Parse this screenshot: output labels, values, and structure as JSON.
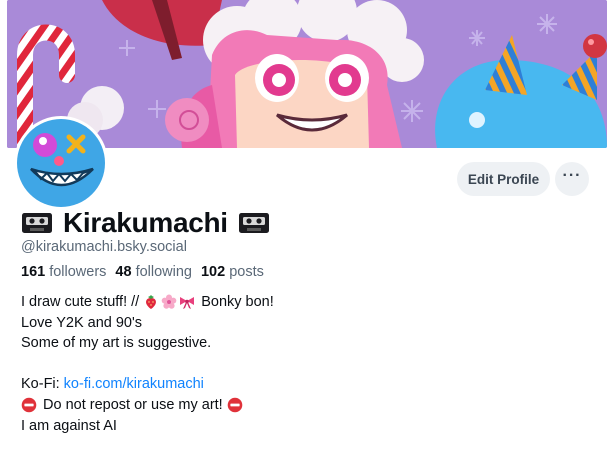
{
  "profile": {
    "display_name": "Kirakumachi",
    "name_prefix_icon": "videocassette-icon",
    "name_suffix_icon": "videocassette-icon",
    "handle": "@kirakumachi.bsky.social",
    "followers_count": "161",
    "followers_label": "followers",
    "following_count": "48",
    "following_label": "following",
    "posts_count": "102",
    "posts_label": "posts"
  },
  "actions": {
    "edit_label": "Edit Profile",
    "more_label": "···"
  },
  "bio": {
    "line1_text": "I draw cute stuff! //",
    "line1_emojis": [
      "strawberry-icon",
      "cherry-blossom-icon",
      "ribbon-icon"
    ],
    "line1_suffix": "Bonky bon!",
    "line2": "Love Y2K and 90's",
    "line3": "Some of my art is suggestive.",
    "line5_label": "Ko-Fi:",
    "line5_link": "ko-fi.com/kirakumachi",
    "line6_icon": "no-entry-icon",
    "line6_text": "Do not repost or use my art!",
    "line7": "I am against AI"
  },
  "colors": {
    "accent_link": "#1083fe",
    "banner_bg": "#9d7ed0",
    "avatar_bg": "#3fa6e6",
    "button_bg": "#eef1f4",
    "muted_text": "#5a6877"
  }
}
